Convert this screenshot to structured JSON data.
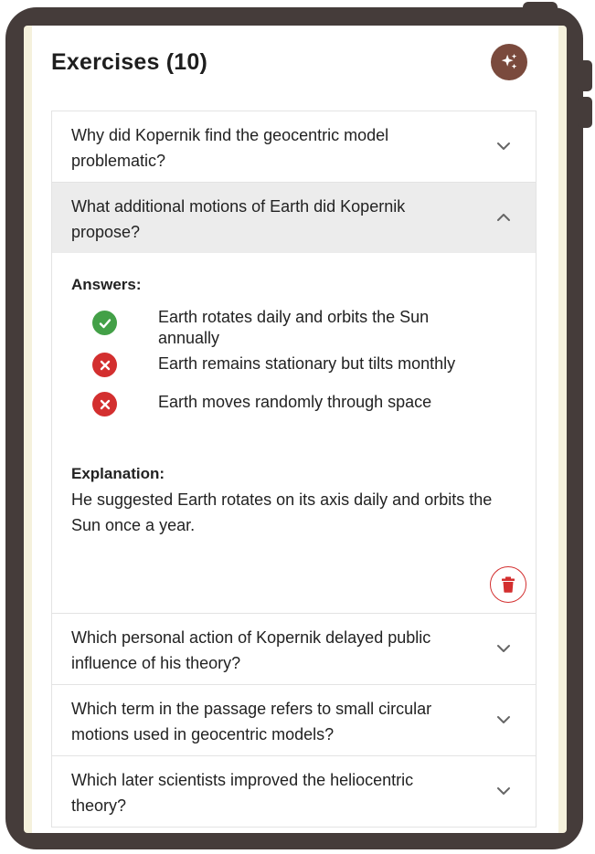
{
  "header": {
    "title": "Exercises (10)",
    "ai_icon": "sparkles-icon",
    "ai_button_color": "#7a4a3d"
  },
  "exercises": [
    {
      "question": "Why did Kopernik find the geocentric model problematic?",
      "expanded": false
    },
    {
      "question": "What additional motions of Earth did Kopernik propose?",
      "expanded": true,
      "answers_label": "Answers:",
      "answers": [
        {
          "text": "Earth rotates daily and orbits the Sun annually",
          "correct": true,
          "icon": "check-circle-icon"
        },
        {
          "text": "Earth remains stationary but tilts monthly",
          "correct": false,
          "icon": "x-circle-icon"
        },
        {
          "text": "Earth moves randomly through space",
          "correct": false,
          "icon": "x-circle-icon"
        }
      ],
      "explanation_label": "Explanation:",
      "explanation": "He suggested Earth rotates on its axis daily and orbits the Sun once a year.",
      "delete_icon": "trash-icon"
    },
    {
      "question": "Which personal action of Kopernik delayed public influence of his theory?",
      "expanded": false
    },
    {
      "question": "Which term in the passage refers to small circular motions used in geocentric models?",
      "expanded": false
    },
    {
      "question": "Which later scientists improved the heliocentric theory?",
      "expanded": false
    }
  ],
  "colors": {
    "correct": "#43a047",
    "incorrect": "#d32f2f",
    "frame": "#453c3a",
    "expanded_row": "#ececec"
  }
}
